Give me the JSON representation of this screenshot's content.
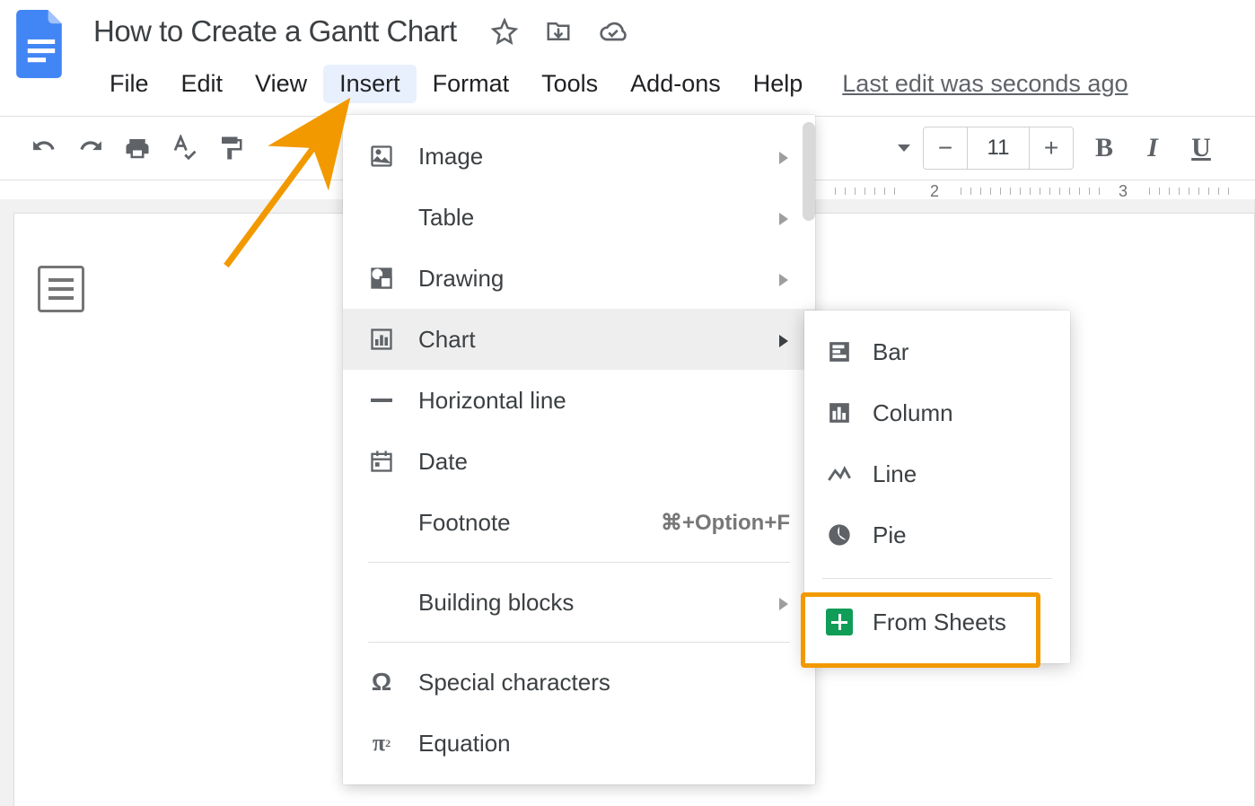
{
  "doc": {
    "title": "How to Create a Gantt Chart"
  },
  "menubar": {
    "items": [
      "File",
      "Edit",
      "View",
      "Insert",
      "Format",
      "Tools",
      "Add-ons",
      "Help"
    ],
    "active_index": 3,
    "last_edit": "Last edit was seconds ago"
  },
  "toolbar": {
    "font_size": "11",
    "bold": "B",
    "italic": "I",
    "underline": "U"
  },
  "ruler": {
    "marks": [
      "2",
      "3"
    ]
  },
  "insert_menu": {
    "items": [
      {
        "icon": "image-icon",
        "label": "Image",
        "submenu": true
      },
      {
        "icon": "",
        "label": "Table",
        "submenu": true
      },
      {
        "icon": "drawing-icon",
        "label": "Drawing",
        "submenu": true
      },
      {
        "icon": "chart-icon",
        "label": "Chart",
        "submenu": true,
        "hover": true
      },
      {
        "icon": "hline-icon",
        "label": "Horizontal line"
      },
      {
        "icon": "date-icon",
        "label": "Date"
      },
      {
        "icon": "",
        "label": "Footnote",
        "shortcut": "⌘+Option+F"
      },
      {
        "sep": true
      },
      {
        "icon": "",
        "label": "Building blocks",
        "submenu": true
      },
      {
        "sep": true
      },
      {
        "icon": "omega-icon",
        "label": "Special characters"
      },
      {
        "icon": "pi-icon",
        "label": "Equation"
      }
    ]
  },
  "chart_submenu": {
    "items": [
      {
        "icon": "bar-icon",
        "label": "Bar"
      },
      {
        "icon": "column-icon",
        "label": "Column"
      },
      {
        "icon": "line-icon",
        "label": "Line"
      },
      {
        "icon": "pie-icon",
        "label": "Pie"
      },
      {
        "sep": true
      },
      {
        "icon": "sheets-icon",
        "label": "From Sheets",
        "highlight": true
      }
    ]
  }
}
